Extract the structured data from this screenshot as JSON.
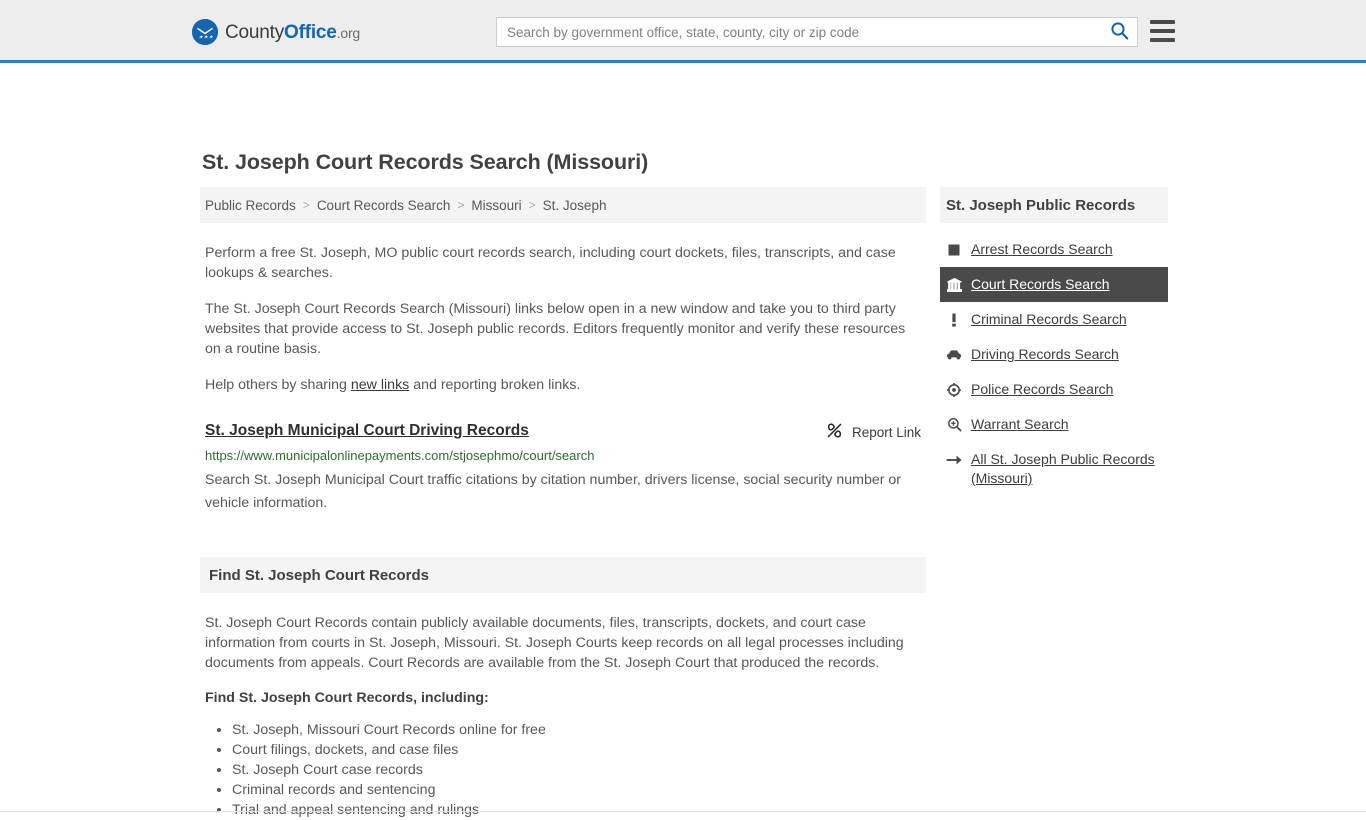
{
  "header": {
    "brand": {
      "county": "County",
      "office": "Office",
      "org": ".org",
      "logo_icon": "eagle-shield-logo"
    },
    "search": {
      "placeholder": "Search by government office, state, county, city or zip code",
      "value": "",
      "button_icon": "search-icon"
    },
    "menu_icon": "hamburger-menu-icon"
  },
  "page": {
    "title": "St. Joseph Court Records Search (Missouri)"
  },
  "breadcrumb": {
    "separator": ">",
    "items": [
      {
        "label": "Public Records"
      },
      {
        "label": "Court Records Search"
      },
      {
        "label": "Missouri"
      },
      {
        "label": "St. Joseph"
      }
    ]
  },
  "intro": {
    "paragraph1": "Perform a free St. Joseph, MO public court records search, including court dockets, files, transcripts, and case lookups & searches.",
    "paragraph2": "The St. Joseph Court Records Search (Missouri) links below open in a new window and take you to third party websites that provide access to St. Joseph public records. Editors frequently monitor and verify these resources on a routine basis.",
    "help_prefix": "Help others by sharing ",
    "help_link": "new links",
    "help_suffix": " and reporting broken links."
  },
  "result": {
    "title": "St. Joseph Municipal Court Driving Records",
    "url": "https://www.municipalonlinepayments.com/stjosephmo/court/search",
    "description": "Search St. Joseph Municipal Court traffic citations by citation number, drivers license, social security number or vehicle information.",
    "report_label": "Report Link",
    "report_icon": "broken-link-icon"
  },
  "find_section": {
    "heading": "Find St. Joseph Court Records",
    "body": "St. Joseph Court Records contain publicly available documents, files, transcripts, dockets, and court case information from courts in St. Joseph, Missouri. St. Joseph Courts keep records on all legal processes including documents from appeals. Court Records are available from the St. Joseph Court that produced the records.",
    "subheading": "Find St. Joseph Court Records, including:",
    "items": [
      "St. Joseph, Missouri Court Records online for free",
      "Court filings, dockets, and case files",
      "St. Joseph Court case records",
      "Criminal records and sentencing",
      "Trial and appeal sentencing and rulings"
    ]
  },
  "sidebar": {
    "heading": "St. Joseph Public Records",
    "items": [
      {
        "label": "Arrest Records Search",
        "icon": "square-icon",
        "active": false
      },
      {
        "label": "Court Records Search",
        "icon": "courthouse-icon",
        "active": true
      },
      {
        "label": "Criminal Records Search",
        "icon": "exclamation-icon",
        "active": false
      },
      {
        "label": "Driving Records Search",
        "icon": "car-icon",
        "active": false
      },
      {
        "label": "Police Records Search",
        "icon": "badge-target-icon",
        "active": false
      },
      {
        "label": "Warrant Search",
        "icon": "magnifier-plus-icon",
        "active": false
      },
      {
        "label": "All St. Joseph Public Records (Missouri)",
        "icon": "arrow-right-icon",
        "active": false
      }
    ]
  },
  "colors": {
    "header_bg": "#ededed",
    "accent_blue": "#3d7aae",
    "brand_blue": "#1565b0",
    "panel_bg": "#f4f4f4",
    "active_bg": "#4a4a4a",
    "url_green": "#2f6b2f",
    "text": "#58585a"
  }
}
